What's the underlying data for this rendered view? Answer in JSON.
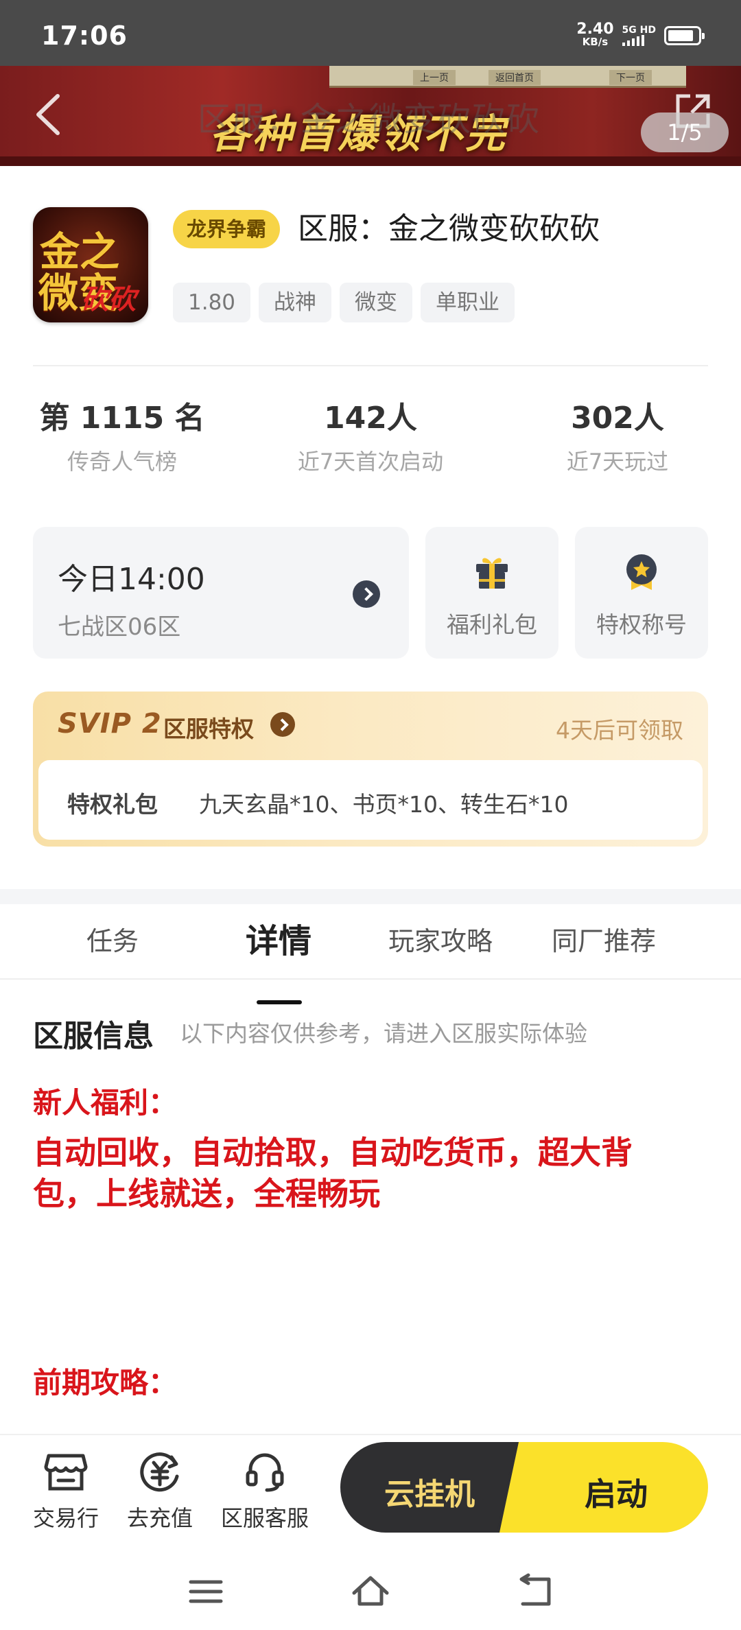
{
  "status_bar": {
    "time": "17:06",
    "net_speed_value": "2.40",
    "net_speed_unit": "KB/s",
    "network": "5G HD",
    "icons": [
      "signal-icon",
      "battery-icon"
    ]
  },
  "banner": {
    "slogan": "各种首爆领不完",
    "overlay_title": "区服：金之微变砍砍砍",
    "page_indicator": "1/5",
    "deco_buttons": [
      "上一页",
      "返回首页",
      "下一页"
    ],
    "icons": [
      "back-arrow-icon",
      "share-icon"
    ]
  },
  "game": {
    "icon_text": [
      "金之",
      "微变",
      "砍砍"
    ],
    "badge": "龙界争霸",
    "name": "区服：金之微变砍砍砍",
    "tags": [
      "1.80",
      "战神",
      "微变",
      "单职业"
    ]
  },
  "stats": [
    {
      "value": "第 1115 名",
      "label": "传奇人气榜"
    },
    {
      "value": "142人",
      "label": "近7天首次启动"
    },
    {
      "value": "302人",
      "label": "近7天玩过"
    }
  ],
  "open_server": {
    "time": "今日14:00",
    "zone": "七战区06区"
  },
  "quick_cards": [
    {
      "label": "福利礼包",
      "icon": "gift-icon"
    },
    {
      "label": "特权称号",
      "icon": "medal-icon"
    }
  ],
  "svip": {
    "logo": "SVIP 2",
    "title": "区服特权",
    "claim_text": "4天后可领取",
    "perk_key": "特权礼包",
    "perk_value": "九天玄晶*10、书页*10、转生石*10"
  },
  "tabs": [
    "任务",
    "详情",
    "玩家攻略",
    "同厂推荐"
  ],
  "active_tab": 1,
  "detail": {
    "section_title": "区服信息",
    "section_note": "以下内容仅供参考，请进入区服实际体验",
    "welfare_head": "新人福利：",
    "welfare_body": "自动回收，自动拾取，自动吃货币，超大背包，上线就送，全程畅玩",
    "guide_head": "前期攻略："
  },
  "bottom_actions": [
    {
      "label": "交易行",
      "icon": "shop-icon"
    },
    {
      "label": "去充值",
      "icon": "recharge-icon"
    },
    {
      "label": "区服客服",
      "icon": "headset-icon"
    }
  ],
  "buttons": {
    "cloud": "云挂机",
    "start": "启动"
  },
  "colors": {
    "accent_yellow": "#fbe12a",
    "badge_yellow": "#f7d447",
    "red_text": "#d9151b",
    "dark_button": "#2f2f31"
  }
}
